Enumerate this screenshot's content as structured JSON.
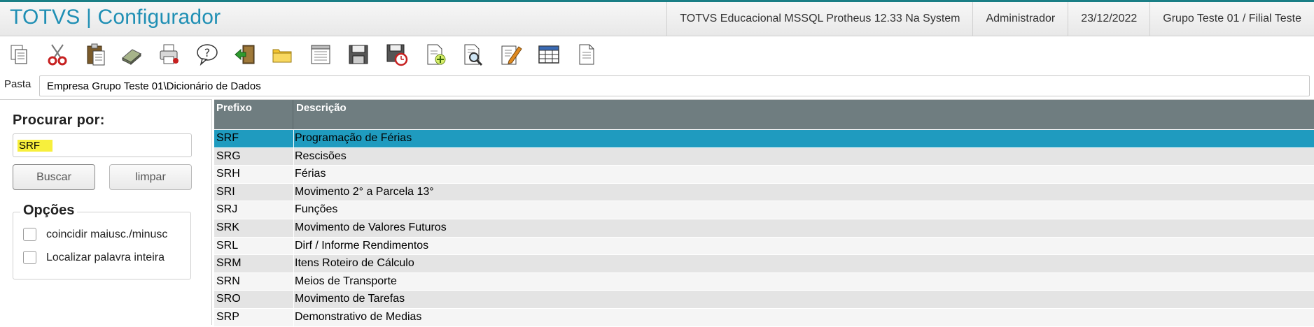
{
  "app": {
    "title": "TOTVS | Configurador"
  },
  "header": {
    "environment": "TOTVS Educacional MSSQL Protheus 12.33 Na System",
    "user": "Administrador",
    "date": "23/12/2022",
    "company": "Grupo Teste 01 / Filial Teste"
  },
  "toolbar": {
    "icons": [
      "copy-icon",
      "cut-icon",
      "paste-icon",
      "eraser-icon",
      "print-icon",
      "help-icon",
      "exit-icon",
      "folder-icon",
      "list-icon",
      "save-icon",
      "save-timer-icon",
      "new-document-icon",
      "search-document-icon",
      "edit-icon",
      "table-icon",
      "document-icon"
    ]
  },
  "folder": {
    "label": "Pasta",
    "path": "Empresa Grupo Teste 01\\Dicionário de Dados"
  },
  "search": {
    "title": "Procurar por:",
    "value": "SRF",
    "search_button": "Buscar",
    "clear_button": "limpar"
  },
  "options": {
    "title": "Opções",
    "match_case": "coincidir maiusc./minusc",
    "whole_word": "Localizar palavra inteira"
  },
  "grid": {
    "columns": [
      "Prefixo",
      "Descrição"
    ],
    "rows": [
      {
        "prefix": "SRF",
        "description": "Programação de Férias",
        "selected": true
      },
      {
        "prefix": "SRG",
        "description": "Rescisões"
      },
      {
        "prefix": "SRH",
        "description": "Férias"
      },
      {
        "prefix": "SRI",
        "description": "Movimento 2° a Parcela 13°"
      },
      {
        "prefix": "SRJ",
        "description": "Funções"
      },
      {
        "prefix": "SRK",
        "description": "Movimento de Valores Futuros"
      },
      {
        "prefix": "SRL",
        "description": "Dirf / Informe Rendimentos"
      },
      {
        "prefix": "SRM",
        "description": "Itens Roteiro de Cálculo"
      },
      {
        "prefix": "SRN",
        "description": "Meios de Transporte"
      },
      {
        "prefix": "SRO",
        "description": "Movimento de Tarefas"
      },
      {
        "prefix": "SRP",
        "description": "Demonstrativo de Medias"
      }
    ]
  },
  "colors": {
    "accent": "#1f8fb4",
    "selection": "#1f9bbf",
    "grid_header": "#6f7d80",
    "highlight": "#f7ef3c"
  }
}
